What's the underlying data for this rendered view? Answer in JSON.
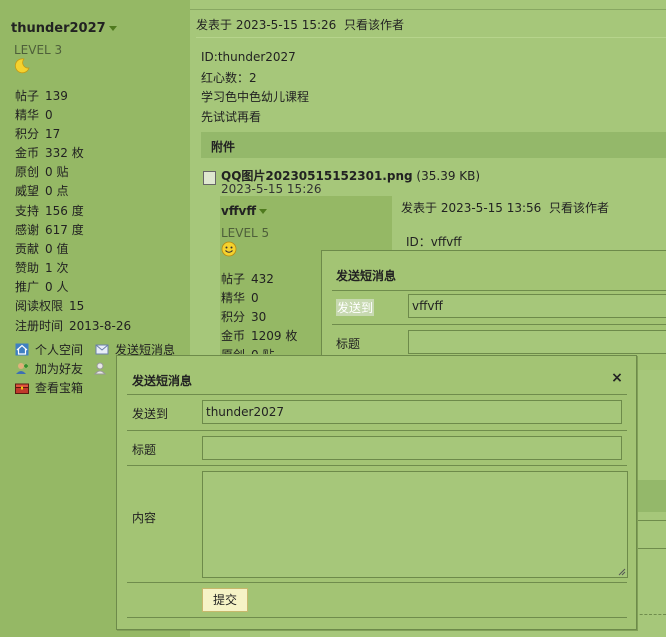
{
  "sidebar": {
    "username": "thunder2027",
    "level": "LEVEL 3",
    "stats": [
      {
        "label": "帖子",
        "value": "139"
      },
      {
        "label": "精华",
        "value": "0"
      },
      {
        "label": "积分",
        "value": "17"
      },
      {
        "label": "金币",
        "value": "332 枚"
      },
      {
        "label": "原创",
        "value": "0 贴"
      },
      {
        "label": "威望",
        "value": "0 点"
      },
      {
        "label": "支持",
        "value": "156 度"
      },
      {
        "label": "感谢",
        "value": "617 度"
      },
      {
        "label": "贡献",
        "value": "0 值"
      },
      {
        "label": "赞助",
        "value": "1 次"
      },
      {
        "label": "推广",
        "value": "0 人"
      },
      {
        "label": "阅读权限",
        "value": "15"
      },
      {
        "label": "注册时间",
        "value": "2013-8-26"
      }
    ],
    "actions": {
      "space": "个人空间",
      "send_msg": "发送短消息",
      "add_friend": "加为好友",
      "treasure": "查看宝箱"
    }
  },
  "post": {
    "meta": "发表于 2023-5-15 15:26  只看该作者",
    "lines": [
      "ID:thunder2027",
      "红心数：2",
      "学习色中色幼儿课程",
      "先试试再看"
    ],
    "attach_header": "附件",
    "file_name": "QQ图片20230515152301.png",
    "file_size": "(35.39 KB)",
    "file_date": "2023-5-15 15:26"
  },
  "nested": {
    "username": "vffvff",
    "level": "LEVEL 5",
    "meta": "发表于 2023-5-15 13:56  只看该作者",
    "id_line": "ID：vffvff",
    "stats": [
      {
        "label": "帖子",
        "value": "432"
      },
      {
        "label": "精华",
        "value": "0"
      },
      {
        "label": "积分",
        "value": "30"
      },
      {
        "label": "金币",
        "value": "1209 枚"
      },
      {
        "label": "原创",
        "value": "0 贴"
      }
    ]
  },
  "dialog_back": {
    "title": "发送短消息",
    "to_label": "发送到",
    "to_value": "vffvff",
    "subject_label": "标题"
  },
  "dialog_front": {
    "title": "发送短消息",
    "close": "×",
    "to_label": "发送到",
    "to_value": "thunder2027",
    "subject_label": "标题",
    "subject_value": "",
    "content_label": "内容",
    "submit": "提交"
  },
  "colors": {
    "sidebar_bg": "#95b865",
    "main_bg": "#a6c77a",
    "dialog_bg": "#a3c474",
    "submit_bg": "#f6f3c6"
  }
}
